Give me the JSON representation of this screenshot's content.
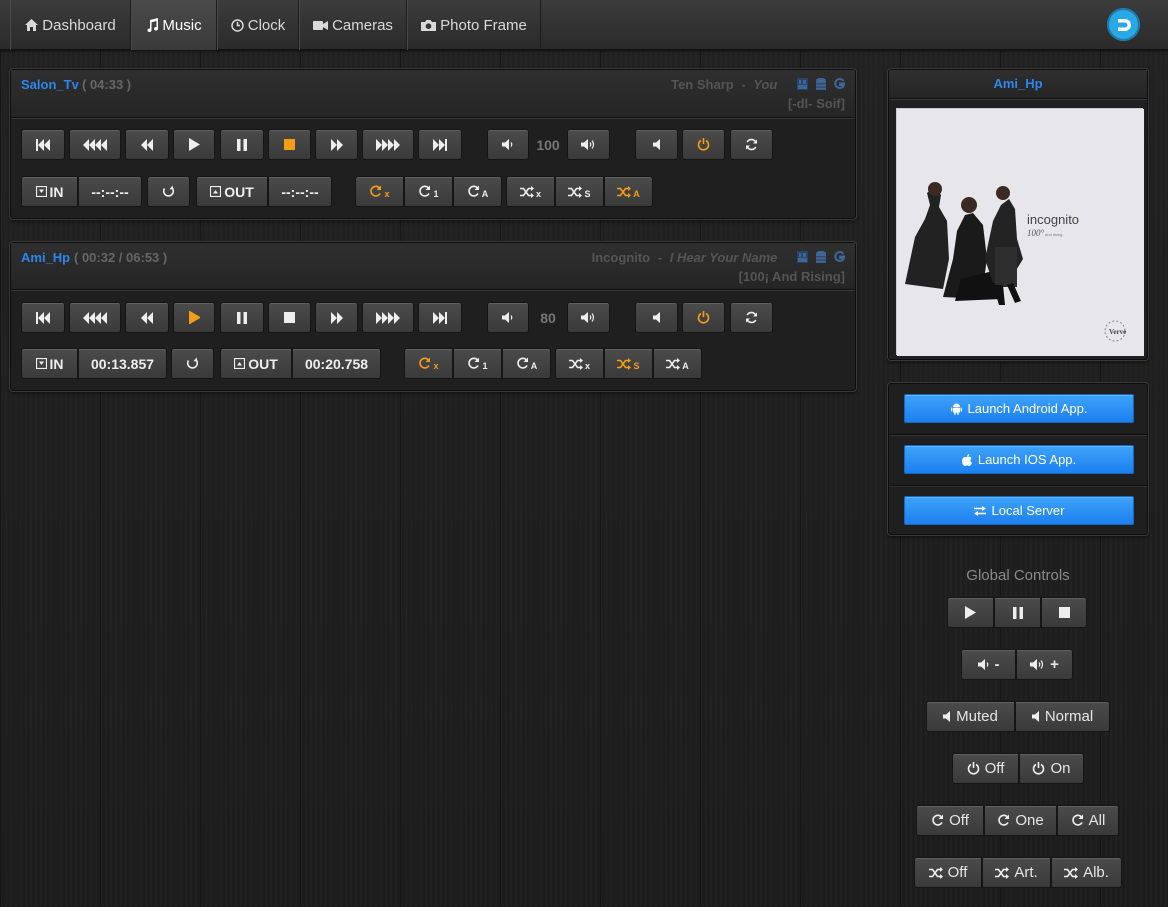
{
  "nav": {
    "tabs": [
      {
        "label": "Dashboard",
        "icon": "home-icon"
      },
      {
        "label": "Music",
        "icon": "music-icon"
      },
      {
        "label": "Clock",
        "icon": "clock-icon"
      },
      {
        "label": "Cameras",
        "icon": "video-camera-icon"
      },
      {
        "label": "Photo Frame",
        "icon": "camera-icon"
      }
    ],
    "active_tab": "Music",
    "brand_icon": "domoticz-logo"
  },
  "players": [
    {
      "name": "Salon_Tv",
      "time": "( 04:33 )",
      "artist": "Ten Sharp",
      "separator": "-",
      "title": "You",
      "album": "[-dl- Soif]",
      "volume": "100",
      "in_label": "IN",
      "in_time": "--:--:--",
      "out_label": "OUT",
      "out_time": "--:--:--",
      "active_transport": "stop",
      "repeat_active": "x",
      "shuffle_active": "a"
    },
    {
      "name": "Ami_Hp",
      "time": "( 00:32 / 06:53 )",
      "artist": "Incognito",
      "separator": "-",
      "title": "I Hear Your Name",
      "album": "[100¡ And Rising]",
      "volume": "80",
      "in_label": "IN",
      "in_time": "00:13.857",
      "out_label": "OUT",
      "out_time": "00:20.758",
      "active_transport": "play",
      "repeat_active": "x",
      "shuffle_active": "s"
    }
  ],
  "side": {
    "player_name": "Ami_Hp",
    "cover": {
      "artist_text": "incognito",
      "album_text": "100°",
      "album_sub": "and rising",
      "label_logo": "Verve"
    },
    "launch_android": "Launch Android App.",
    "launch_ios": "Launch IOS App.",
    "local_server": "Local Server"
  },
  "global": {
    "title": "Global Controls",
    "vol_minus": "-",
    "vol_plus": "+",
    "muted": "Muted",
    "normal": "Normal",
    "power_off": "Off",
    "power_on": "On",
    "repeat_off": "Off",
    "repeat_one": "One",
    "repeat_all": "All",
    "shuffle_off": "Off",
    "shuffle_art": "Art.",
    "shuffle_alb": "Alb."
  },
  "colors": {
    "accent": "#2d86ee",
    "active": "#f59d16",
    "launch": "#2a8ff4"
  }
}
